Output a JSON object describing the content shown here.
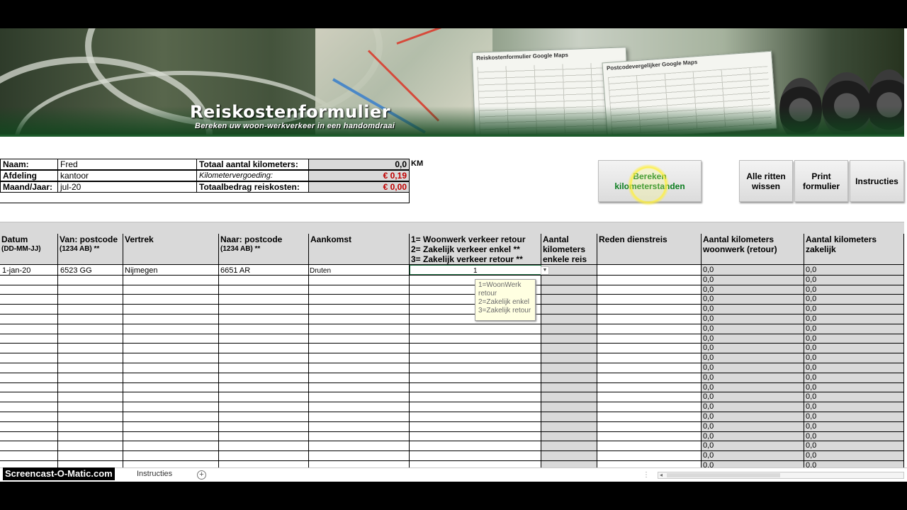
{
  "banner": {
    "title": "Reiskostenformulier",
    "subtitle": "Bereken uw woon-werkverkeer in een handomdraai",
    "doc1_title": "Reiskostenformulier Google Maps",
    "doc2_title": "Postcodevergelijker Google Maps"
  },
  "info": {
    "naam_label": "Naam:",
    "naam_value": "Fred",
    "afdeling_label": "Afdeling",
    "afdeling_value": "kantoor",
    "maand_label": "Maand/Jaar:",
    "maand_value": "jul-20",
    "totaal_km_label": "Totaal aantal kilometers:",
    "totaal_km_value": "0,0",
    "totaal_km_unit": "KM",
    "vergoeding_label": "Kilometervergoeding:",
    "vergoeding_value": "€ 0,19",
    "bedrag_label": "Totaalbedrag reiskosten:",
    "bedrag_value": "€ 0,00"
  },
  "buttons": {
    "bereken": "Bereken kilometerstanden",
    "alle_ritten": "Alle ritten wissen",
    "print": "Print formulier",
    "instructies": "Instructies"
  },
  "headers": {
    "datum": "Datum",
    "datum_sub": "(DD-MM-JJ)",
    "van": "Van: postcode",
    "van_sub": "(1234 AB) **",
    "vertrek": "Vertrek",
    "naar": "Naar: postcode",
    "naar_sub": "(1234 AB) **",
    "aankomst": "Aankomst",
    "type_1": "1= Woonwerk verkeer retour",
    "type_2": "2= Zakelijk verkeer enkel **",
    "type_3": "3= Zakelijk verkeer retour **",
    "aantal_enkel": "Aantal kilometers enkele reis",
    "reden": "Reden dienstreis",
    "km_woonwerk": "Aantal kilometers woonwerk (retour)",
    "km_zakelijk": "Aantal kilometers zakelijk"
  },
  "first_row": {
    "datum": "1-jan-20",
    "van": "6523 GG",
    "vertrek": "Nijmegen",
    "naar": "6651 AR",
    "aankomst": "Druten",
    "type": "1"
  },
  "zero_value": "0,0",
  "tooltip": {
    "line1": "1=WoonWerk",
    "line2": "retour",
    "line3": "2=Zakelijk enkel",
    "line4": "3=Zakelijk retour"
  },
  "bottom": {
    "logo": "Screencast-O-Matic.com",
    "tab": "Instructies",
    "add": "+"
  },
  "colors": {
    "accent_green": "#0b7d1f",
    "money_red": "#c00000",
    "header_gray": "#d9d9d9"
  }
}
